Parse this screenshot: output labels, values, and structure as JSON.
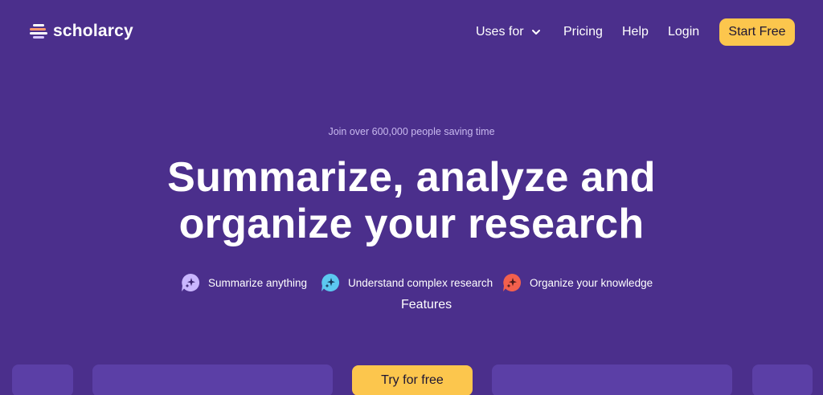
{
  "brand": {
    "name": "scholarcy"
  },
  "nav": {
    "links": [
      {
        "label": "Features"
      },
      {
        "label": "Uses for"
      },
      {
        "label": "Pricing"
      },
      {
        "label": "Help"
      },
      {
        "label": "Login"
      }
    ],
    "cta": "Start Free"
  },
  "hero": {
    "eyebrow": "Join over 600,000 people saving time",
    "headline_line1": "Summarize, analyze and",
    "headline_line2": "organize your research",
    "features": [
      {
        "label": "Summarize anything",
        "icon": "sparkle-bubble-icon",
        "color": "#c9b6ff"
      },
      {
        "label": "Understand complex research",
        "icon": "sparkle-bubble-icon",
        "color": "#5cc8f0"
      },
      {
        "label": "Organize your knowledge",
        "icon": "sparkle-bubble-icon",
        "color": "#f2604d"
      }
    ],
    "cta": "Try for free"
  },
  "colors": {
    "background": "#4b2f8c",
    "accent": "#fcc64d",
    "card": "#5b3fa6"
  }
}
